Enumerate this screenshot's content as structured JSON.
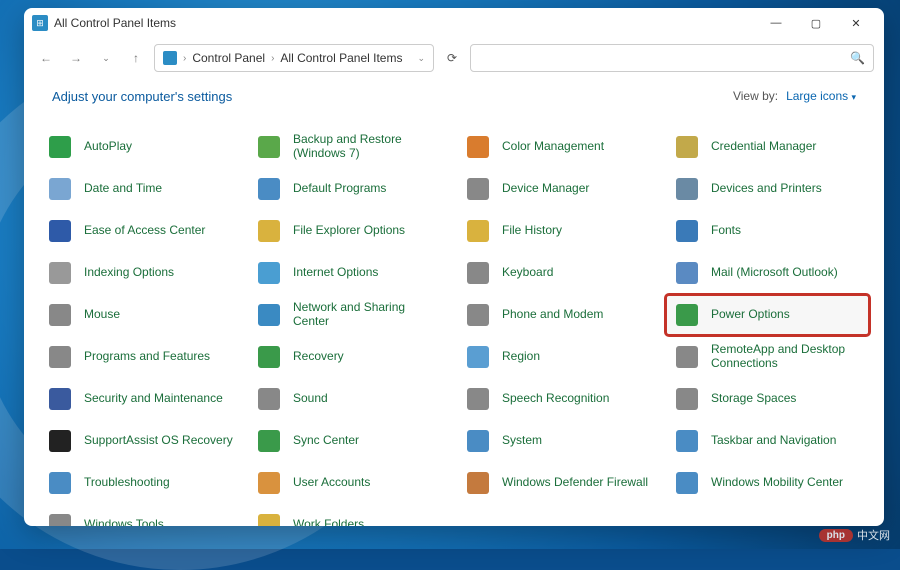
{
  "window": {
    "title": "All Control Panel Items"
  },
  "breadcrumb": {
    "root": "Control Panel",
    "current": "All Control Panel Items"
  },
  "header": {
    "heading": "Adjust your computer's settings",
    "viewby_label": "View by:",
    "viewby_value": "Large icons"
  },
  "watermark": {
    "badge": "php",
    "text": "中文网"
  },
  "items": [
    {
      "label": "AutoPlay",
      "bg": "#2e9e4a"
    },
    {
      "label": "Backup and Restore (Windows 7)",
      "bg": "#5aa84a"
    },
    {
      "label": "Color Management",
      "bg": "#d97c2e"
    },
    {
      "label": "Credential Manager",
      "bg": "#c2a94a"
    },
    {
      "label": "Date and Time",
      "bg": "#7aa6d2"
    },
    {
      "label": "Default Programs",
      "bg": "#4a8cc4"
    },
    {
      "label": "Device Manager",
      "bg": "#888"
    },
    {
      "label": "Devices and Printers",
      "bg": "#6a8aa4"
    },
    {
      "label": "Ease of Access Center",
      "bg": "#2e5aa8"
    },
    {
      "label": "File Explorer Options",
      "bg": "#d9b23e"
    },
    {
      "label": "File History",
      "bg": "#d9b23e"
    },
    {
      "label": "Fonts",
      "bg": "#3a7ab8"
    },
    {
      "label": "Indexing Options",
      "bg": "#999"
    },
    {
      "label": "Internet Options",
      "bg": "#4a9ed2"
    },
    {
      "label": "Keyboard",
      "bg": "#888"
    },
    {
      "label": "Mail (Microsoft Outlook)",
      "bg": "#5a8ac2"
    },
    {
      "label": "Mouse",
      "bg": "#888"
    },
    {
      "label": "Network and Sharing Center",
      "bg": "#3a8ac2"
    },
    {
      "label": "Phone and Modem",
      "bg": "#888"
    },
    {
      "label": "Power Options",
      "bg": "#3a9a4a",
      "highlight": true
    },
    {
      "label": "Programs and Features",
      "bg": "#888"
    },
    {
      "label": "Recovery",
      "bg": "#3a9a4a"
    },
    {
      "label": "Region",
      "bg": "#5a9ed2"
    },
    {
      "label": "RemoteApp and Desktop Connections",
      "bg": "#888"
    },
    {
      "label": "Security and Maintenance",
      "bg": "#3a5a9e"
    },
    {
      "label": "Sound",
      "bg": "#888"
    },
    {
      "label": "Speech Recognition",
      "bg": "#888"
    },
    {
      "label": "Storage Spaces",
      "bg": "#888"
    },
    {
      "label": "SupportAssist OS Recovery",
      "bg": "#222"
    },
    {
      "label": "Sync Center",
      "bg": "#3a9a4a"
    },
    {
      "label": "System",
      "bg": "#4a8cc4"
    },
    {
      "label": "Taskbar and Navigation",
      "bg": "#4a8cc4"
    },
    {
      "label": "Troubleshooting",
      "bg": "#4a8cc4"
    },
    {
      "label": "User Accounts",
      "bg": "#d9923e"
    },
    {
      "label": "Windows Defender Firewall",
      "bg": "#c47a3e"
    },
    {
      "label": "Windows Mobility Center",
      "bg": "#4a8cc4"
    },
    {
      "label": "Windows Tools",
      "bg": "#888"
    },
    {
      "label": "Work Folders",
      "bg": "#d9b23e"
    }
  ]
}
